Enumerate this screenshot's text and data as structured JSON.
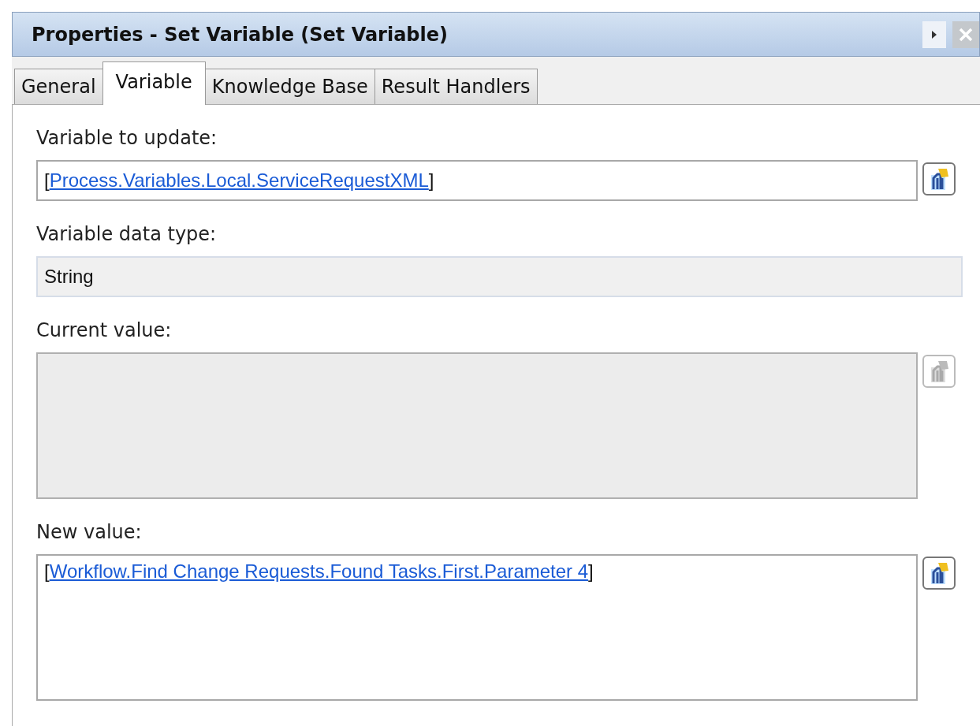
{
  "window": {
    "title": "Properties - Set Variable (Set Variable)"
  },
  "tabs": [
    {
      "label": "General",
      "selected": false
    },
    {
      "label": "Variable",
      "selected": true
    },
    {
      "label": "Knowledge Base",
      "selected": false
    },
    {
      "label": "Result Handlers",
      "selected": false
    }
  ],
  "fields": [
    {
      "kind": "link",
      "label": "Variable to update:",
      "prefix": "[",
      "link": "Process.Variables.Local.ServiceRequestXML",
      "suffix": "]",
      "button": {
        "disabled": false
      }
    },
    {
      "kind": "readonly",
      "label": "Variable data type:",
      "value": "String"
    },
    {
      "kind": "area",
      "label": "Current value:",
      "disabled": true,
      "button": {
        "disabled": true
      }
    },
    {
      "kind": "area",
      "label": "New value:",
      "disabled": false,
      "prefix": "[",
      "link": "Workflow.Find Change Requests.Found Tasks.First.Parameter 4",
      "suffix": "]",
      "button": {
        "disabled": false
      }
    }
  ]
}
